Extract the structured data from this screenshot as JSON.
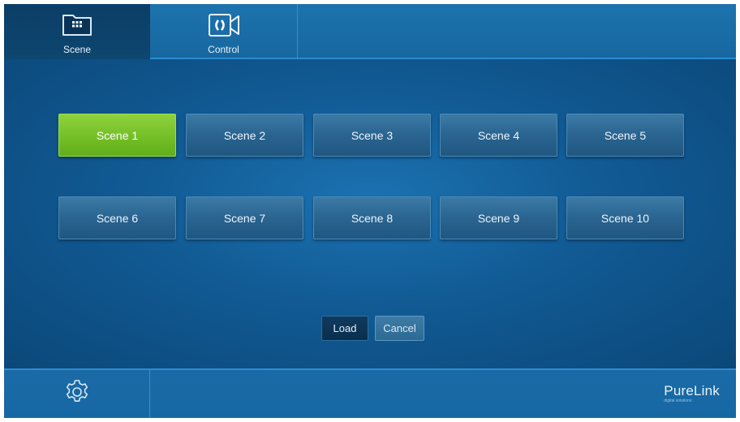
{
  "tabs": {
    "scene_label": "Scene",
    "control_label": "Control",
    "active": "Scene"
  },
  "scenes": [
    {
      "label": "Scene 1",
      "active": true
    },
    {
      "label": "Scene 2",
      "active": false
    },
    {
      "label": "Scene 3",
      "active": false
    },
    {
      "label": "Scene 4",
      "active": false
    },
    {
      "label": "Scene 5",
      "active": false
    },
    {
      "label": "Scene 6",
      "active": false
    },
    {
      "label": "Scene 7",
      "active": false
    },
    {
      "label": "Scene 8",
      "active": false
    },
    {
      "label": "Scene 9",
      "active": false
    },
    {
      "label": "Scene 10",
      "active": false
    }
  ],
  "actions": {
    "load_label": "Load",
    "cancel_label": "Cancel"
  },
  "footer": {
    "settings_icon": "gear-icon",
    "brand_name": "PureLink",
    "brand_tagline": "digital solutions"
  },
  "colors": {
    "background": "#0c4a78",
    "active_scene": "#74bf26",
    "scene_button": "#2a6490",
    "bar": "#1767a0"
  }
}
